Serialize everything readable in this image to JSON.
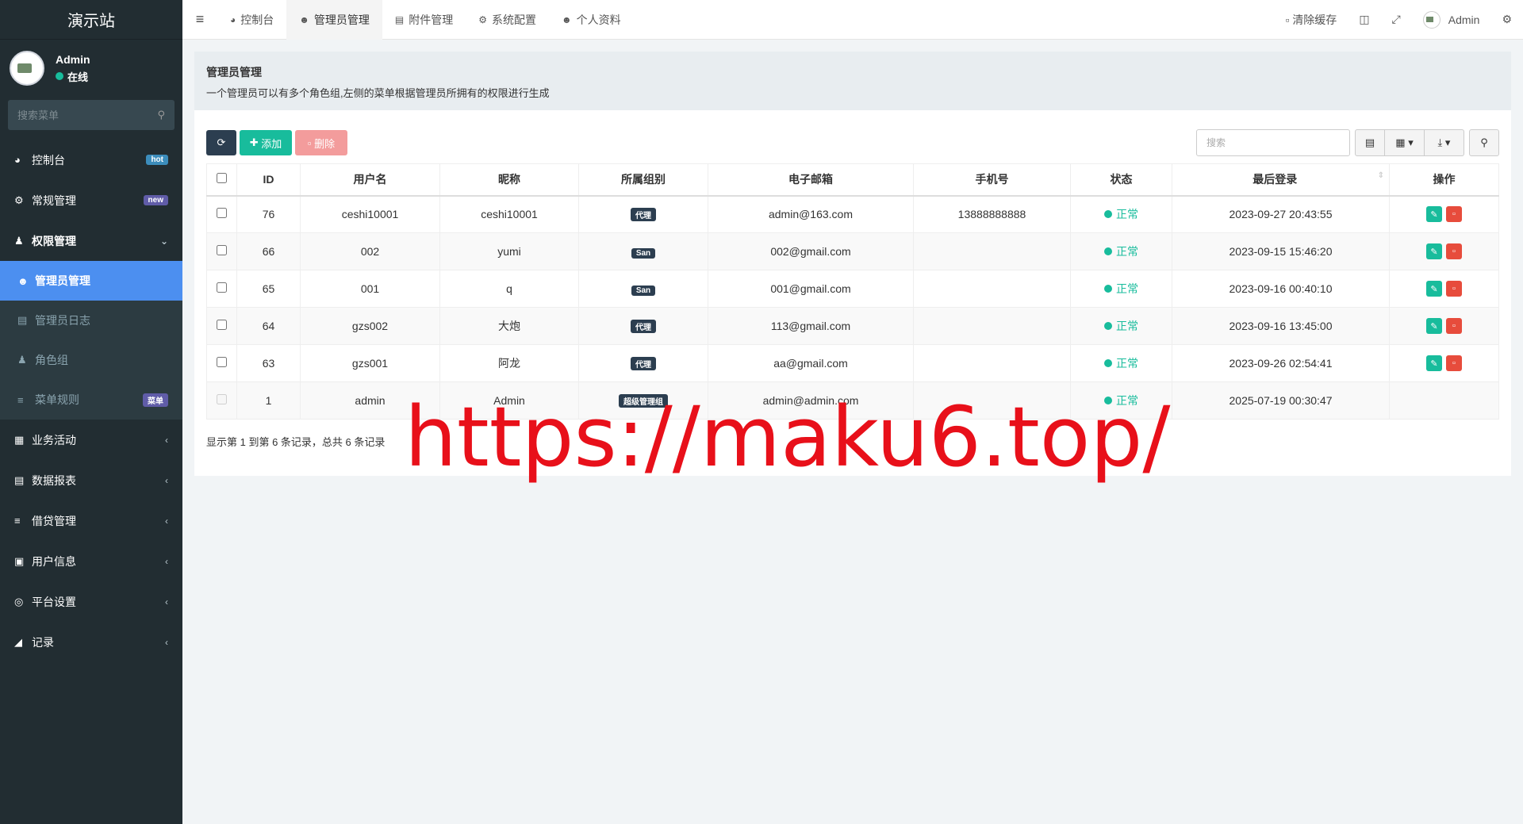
{
  "app": {
    "brand": "演示站"
  },
  "user": {
    "name": "Admin",
    "status": "在线"
  },
  "sidebar": {
    "search_placeholder": "搜索菜单",
    "items": [
      {
        "label": "控制台",
        "badge": "hot",
        "icon": "dashboard-icon"
      },
      {
        "label": "常规管理",
        "badge": "new",
        "icon": "cogs-icon"
      },
      {
        "label": "权限管理",
        "icon": "group-icon"
      },
      {
        "label": "业务活动",
        "icon": "ticket-icon"
      },
      {
        "label": "数据报表",
        "icon": "report-icon"
      },
      {
        "label": "借贷管理",
        "icon": "list-icon"
      },
      {
        "label": "用户信息",
        "icon": "id-card-icon"
      },
      {
        "label": "平台设置",
        "icon": "settings-icon"
      },
      {
        "label": "记录",
        "icon": "area-chart-icon"
      }
    ],
    "sub_items": [
      {
        "label": "管理员管理",
        "icon": "user-icon"
      },
      {
        "label": "管理员日志",
        "icon": "list-alt-icon"
      },
      {
        "label": "角色组",
        "icon": "group-icon"
      },
      {
        "label": "菜单规则",
        "badge": "菜单",
        "icon": "bars-icon"
      }
    ]
  },
  "header": {
    "tabs": [
      "控制台",
      "管理员管理",
      "附件管理",
      "系统配置",
      "个人资料"
    ],
    "clear_cache": "清除缓存",
    "user": "Admin"
  },
  "page": {
    "title": "管理员管理",
    "description": "一个管理员可以有多个角色组,左侧的菜单根据管理员所拥有的权限进行生成"
  },
  "toolbar": {
    "add": "添加",
    "delete": "删除",
    "search_placeholder": "搜索"
  },
  "table": {
    "headers": [
      "ID",
      "用户名",
      "昵称",
      "所属组别",
      "电子邮箱",
      "手机号",
      "状态",
      "最后登录",
      "操作"
    ],
    "rows": [
      {
        "id": "76",
        "username": "ceshi10001",
        "nickname": "ceshi10001",
        "group": "代理",
        "email": "admin@163.com",
        "mobile": "13888888888",
        "status": "正常",
        "last_login": "2023-09-27 20:43:55"
      },
      {
        "id": "66",
        "username": "002",
        "nickname": "yumi",
        "group": "San",
        "email": "002@gmail.com",
        "mobile": "",
        "status": "正常",
        "last_login": "2023-09-15 15:46:20"
      },
      {
        "id": "65",
        "username": "001",
        "nickname": "q",
        "group": "San",
        "email": "001@gmail.com",
        "mobile": "",
        "status": "正常",
        "last_login": "2023-09-16 00:40:10"
      },
      {
        "id": "64",
        "username": "gzs002",
        "nickname": "大炮",
        "group": "代理",
        "email": "113@gmail.com",
        "mobile": "",
        "status": "正常",
        "last_login": "2023-09-16 13:45:00"
      },
      {
        "id": "63",
        "username": "gzs001",
        "nickname": "阿龙",
        "group": "代理",
        "email": "aa@gmail.com",
        "mobile": "",
        "status": "正常",
        "last_login": "2023-09-26 02:54:41"
      },
      {
        "id": "1",
        "username": "admin",
        "nickname": "Admin",
        "group": "超级管理组",
        "email": "admin@admin.com",
        "mobile": "",
        "status": "正常",
        "last_login": "2025-07-19 00:30:47"
      }
    ]
  },
  "pagination": {
    "info": "显示第 1 到第 6 条记录，总共 6 条记录"
  },
  "watermark": "https://maku6.top/",
  "colors": {
    "sidebar_bg": "#222d32",
    "active_blue": "#4c8ff0",
    "success": "#18bc9c",
    "danger": "#e74c3c",
    "dark": "#2c3e50"
  }
}
